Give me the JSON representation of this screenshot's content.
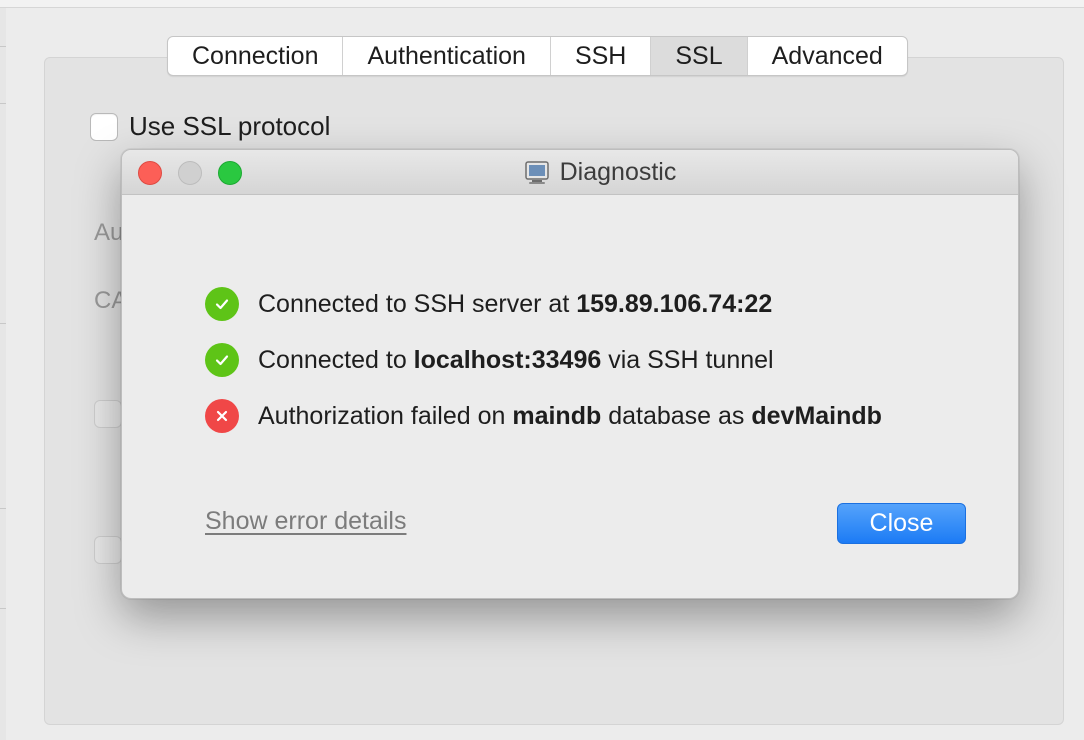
{
  "tabs": [
    {
      "label": "Connection"
    },
    {
      "label": "Authentication"
    },
    {
      "label": "SSH"
    },
    {
      "label": "SSL",
      "active": true
    },
    {
      "label": "Advanced"
    }
  ],
  "form": {
    "ssl_label": "Use SSL protocol",
    "label_auth_partial": "Au",
    "label_ca_partial": "CA"
  },
  "dialog": {
    "title": "Diagnostic",
    "messages": [
      {
        "status": "success",
        "prefix": "Connected to SSH server at ",
        "bold1": "159.89.106.74:22",
        "mid": "",
        "bold2": "",
        "suffix": ""
      },
      {
        "status": "success",
        "prefix": "Connected to ",
        "bold1": "localhost:33496",
        "mid": " via SSH tunnel",
        "bold2": "",
        "suffix": ""
      },
      {
        "status": "error",
        "prefix": "Authorization failed on ",
        "bold1": "maindb",
        "mid": " database as ",
        "bold2": "devMaindb",
        "suffix": ""
      }
    ],
    "details_link": "Show error details",
    "close_label": "Close"
  },
  "colors": {
    "success": "#5ec417",
    "error": "#f04747",
    "accent": "#1c7bf5"
  }
}
